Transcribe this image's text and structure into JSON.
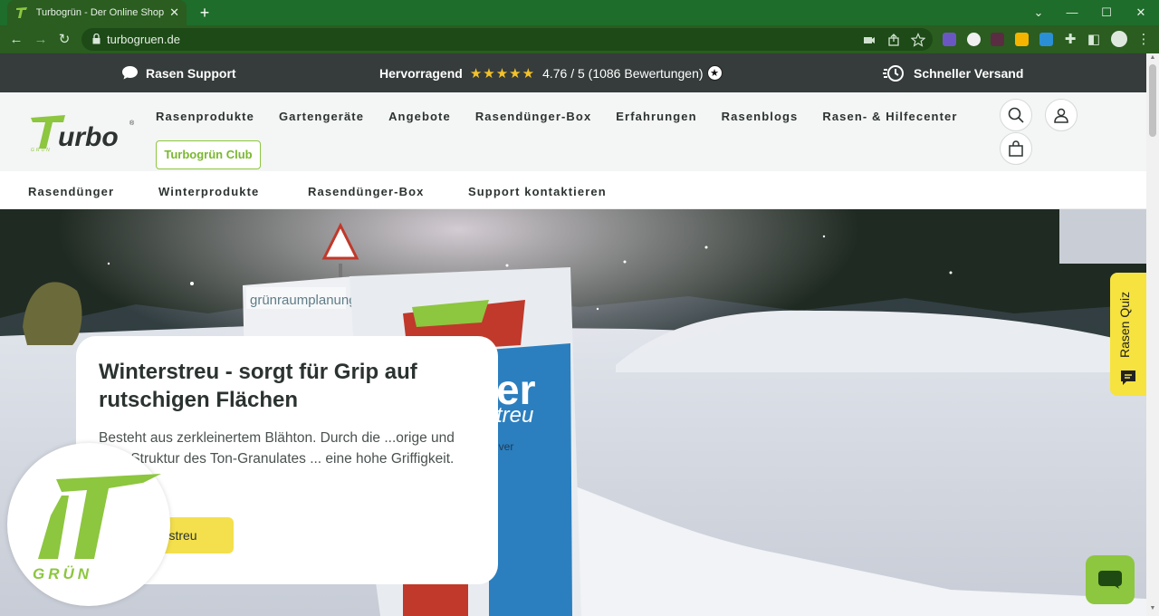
{
  "browser": {
    "tab_title": "Turbogrün - Der Online Shop für",
    "url": "turbogruen.de"
  },
  "announce": {
    "support": "Rasen Support",
    "rating_label": "Hervorragend",
    "rating_text": "4.76 / 5 (1086 Bewertungen)",
    "rating_stars": 5,
    "shipping": "Schneller Versand"
  },
  "nav": {
    "items": [
      "Rasenprodukte",
      "Gartengeräte",
      "Angebote",
      "Rasendünger-Box",
      "Erfahrungen",
      "Rasenblogs",
      "Rasen- & Hilfecenter"
    ],
    "club": "Turbogrün Club"
  },
  "subnav": {
    "items": [
      "Rasendünger",
      "Winterprodukte",
      "Rasendünger-Box",
      "Support kontaktieren"
    ]
  },
  "hero": {
    "title": "Winterstreu - sorgt für Grip auf rutschigen Flächen",
    "text": "Besteht aus zerkleinertem Blähton. Durch die ...orige und raue Struktur des Ton-Granulates ... eine hohe Griffigkeit.",
    "cta": "erstreu",
    "bag_text": "grünraumplanung",
    "logo_text": "GRÜN"
  },
  "widgets": {
    "quiz": "Rasen Quiz"
  },
  "colors": {
    "brand_green": "#8dc63f",
    "accent_yellow": "#f4e04d",
    "topbar": "#353c3b"
  }
}
